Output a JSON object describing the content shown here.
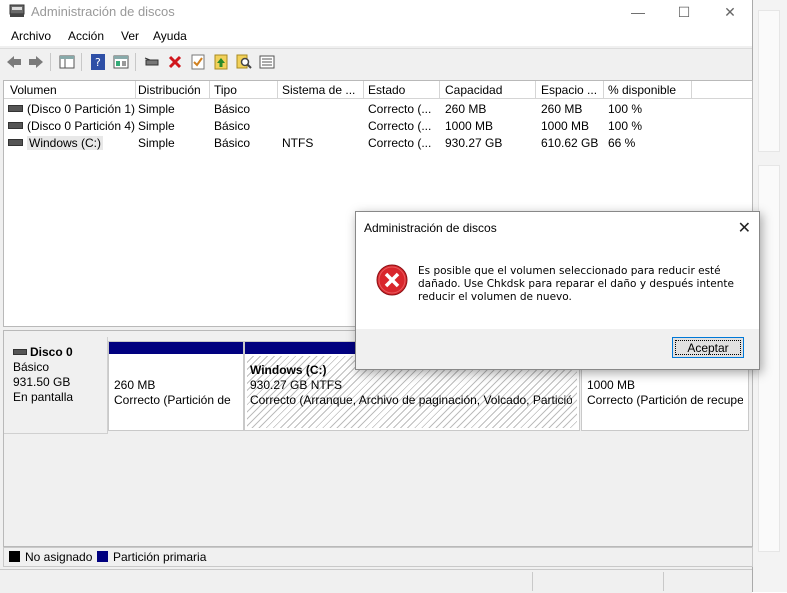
{
  "window": {
    "title": "Administración de discos",
    "controls": {
      "minimize": "—",
      "maximize": "☐",
      "close": "✕"
    }
  },
  "menu": [
    "Archivo",
    "Acción",
    "Ver",
    "Ayuda"
  ],
  "toolbar_icons": [
    "back-arrow-icon",
    "forward-arrow-icon",
    "show-hide-console-tree-icon",
    "help-icon",
    "properties-icon",
    "connect-drive-icon",
    "delete-icon",
    "check-icon",
    "import-icon",
    "search-icon",
    "disk-view-icon"
  ],
  "volumes": {
    "columns": [
      "Volumen",
      "Distribución",
      "Tipo",
      "Sistema de ...",
      "Estado",
      "Capacidad",
      "Espacio ...",
      "% disponible"
    ],
    "rows": [
      [
        "(Disco 0 Partición 1)",
        "Simple",
        "Básico",
        "",
        "Correcto (...",
        "260 MB",
        "260 MB",
        "100 %"
      ],
      [
        "(Disco 0 Partición 4)",
        "Simple",
        "Básico",
        "",
        "Correcto (...",
        "1000 MB",
        "1000 MB",
        "100 %"
      ],
      [
        "Windows (C:)",
        "Simple",
        "Básico",
        "NTFS",
        "Correcto (...",
        "930.27 GB",
        "610.62 GB",
        "66 %"
      ]
    ]
  },
  "disk": {
    "name": "Disco 0",
    "type": "Básico",
    "size": "931.50 GB",
    "status": "En pantalla",
    "partitions": [
      {
        "title": "",
        "size": "260 MB",
        "status": "Correcto (Partición de"
      },
      {
        "title": "Windows  (C:)",
        "size": "930.27 GB NTFS",
        "status": "Correcto (Arranque, Archivo de paginación, Volcado, Partició"
      },
      {
        "title": "",
        "size": "1000 MB",
        "status": "Correcto (Partición de recupe"
      }
    ]
  },
  "legend": [
    {
      "label": "No asignado",
      "color": "#000000"
    },
    {
      "label": "Partición primaria",
      "color": "#00007f"
    }
  ],
  "dialog": {
    "title": "Administración de discos",
    "message_lines": [
      "Es posible que el volumen seleccionado para reducir esté",
      "dañado. Use Chkdsk para reparar el daño y después intente",
      "reducir el volumen de nuevo."
    ],
    "button": "Aceptar",
    "close": "✕"
  }
}
